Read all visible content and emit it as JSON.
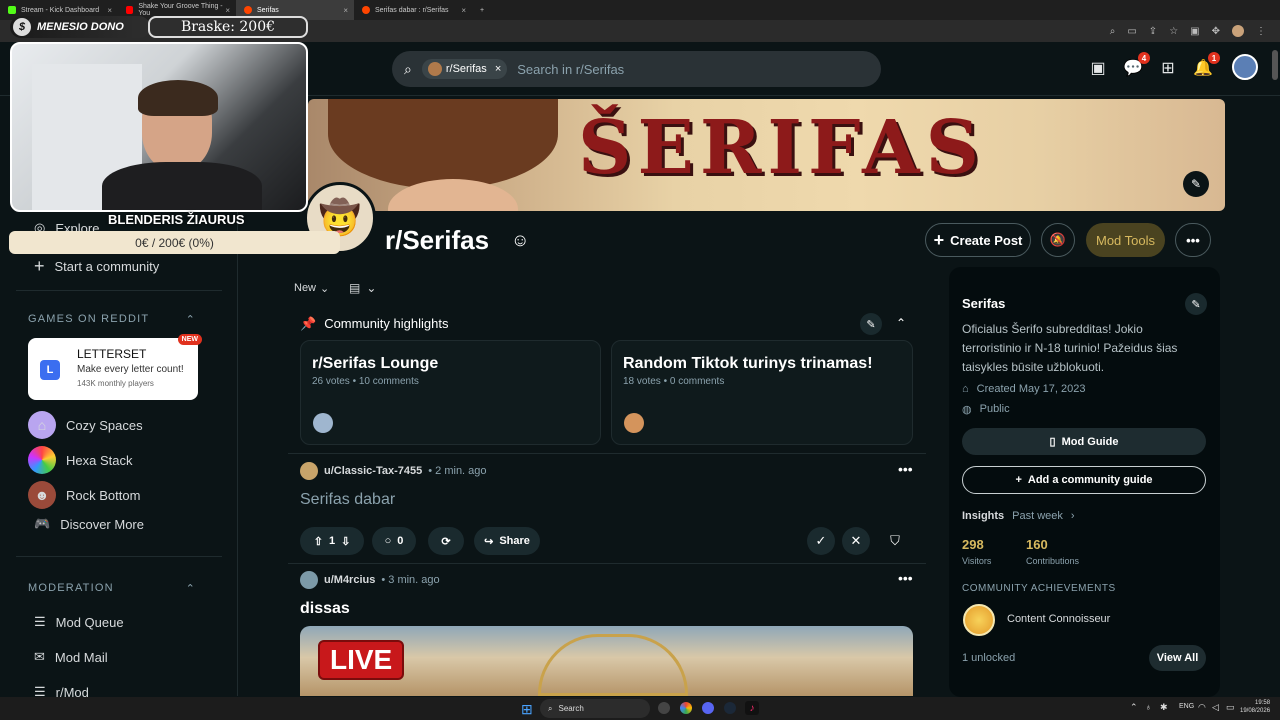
{
  "browser": {
    "tabs": [
      {
        "title": "Stream - Kick Dashboard",
        "color": "#53fc18"
      },
      {
        "title": "Shake Your Groove Thing - You",
        "color": "#ff0000"
      },
      {
        "title": "Serifas",
        "color": "#ff4500"
      },
      {
        "title": "Serifas dabar : r/Serifas",
        "color": "#ff4500"
      }
    ]
  },
  "header": {
    "search_chip": "r/Serifas",
    "search_placeholder": "Search in r/Serifas",
    "chat_badge": "4",
    "notif_badge": "1"
  },
  "overlay": {
    "dono_label": "MENESIO DONO",
    "dono_amount": "Braske: 200€",
    "cam_name": "BLENDERIS ŽIAURUS",
    "goal_progress": "0€ / 200€ (0%)"
  },
  "leftnav": {
    "explore": "Explore",
    "start_community": "Start a community",
    "games_heading": "GAMES ON REDDIT",
    "featured_game": {
      "name": "LETTERSET",
      "desc": "Make every letter count!",
      "players": "143K monthly players",
      "badge": "NEW"
    },
    "games": [
      "Cozy Spaces",
      "Hexa Stack",
      "Rock Bottom",
      "Discover More"
    ],
    "moderation_heading": "MODERATION",
    "mod_items": [
      "Mod Queue",
      "Mod Mail",
      "r/Mod"
    ]
  },
  "banner": {
    "title": "ŠERIFAS"
  },
  "sub": {
    "name": "r/Serifas",
    "create_post": "Create Post",
    "mod_tools": "Mod Tools"
  },
  "feed": {
    "sort": "New",
    "highlights_title": "Community highlights",
    "highlights": [
      {
        "title": "r/Serifas Lounge",
        "meta": "26 votes • 10 comments"
      },
      {
        "title": "Random Tiktok turinys trinamas!",
        "meta": "18 votes • 0 comments"
      }
    ],
    "posts": [
      {
        "user": "u/Classic-Tax-7455",
        "time": "• 2 min. ago",
        "title": "Serifas dabar",
        "votes": "1",
        "comments": "0",
        "share": "Share"
      },
      {
        "user": "u/M4rcius",
        "time": "• 3 min. ago",
        "title": "dissas",
        "image_text": "LIVE"
      }
    ]
  },
  "sidebar": {
    "name": "Serifas",
    "description": "Oficialus Šerifo subredditas! Jokio terroristinio ir N-18 turinio! Pažeidus šias taisykles būsite užblokuoti.",
    "created": "Created May 17, 2023",
    "visibility": "Public",
    "mod_guide": "Mod Guide",
    "add_guide": "Add a community guide",
    "insights": "Insights",
    "past_week": "Past week",
    "visitors_value": "298",
    "visitors_label": "Visitors",
    "contrib_value": "160",
    "contrib_label": "Contributions",
    "achievements_heading": "COMMUNITY ACHIEVEMENTS",
    "achievement": "Content Connoisseur",
    "unlocked": "1 unlocked",
    "view_all": "View All"
  },
  "taskbar": {
    "search": "Search",
    "lang": "ENG",
    "time": "19:58",
    "date": "19/08/2026"
  },
  "colors": {
    "accent": "#d7b95f",
    "mod_tools_bg": "#4a4320",
    "reddit_orange": "#ff4500"
  }
}
